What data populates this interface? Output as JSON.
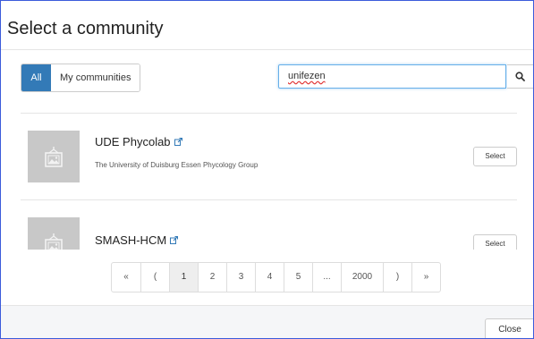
{
  "dialog": {
    "title": "Select a community"
  },
  "filter": {
    "tabs": [
      {
        "label": "All",
        "active": true
      },
      {
        "label": "My communities",
        "active": false
      }
    ]
  },
  "search": {
    "value": "unifezen",
    "icon": "search-icon"
  },
  "communities": [
    {
      "name": "UDE Phycolab",
      "description": "The University of Duisburg Essen Phycology Group",
      "select_label": "Select",
      "thumbnail_icon": "image-placeholder-icon",
      "link_icon": "external-link-icon"
    },
    {
      "name": "SMASH-HCM",
      "description": "",
      "select_label": "Select",
      "thumbnail_icon": "image-placeholder-icon",
      "link_icon": "external-link-icon"
    }
  ],
  "pagination": {
    "first": "«",
    "prev": "(",
    "pages": [
      "1",
      "2",
      "3",
      "4",
      "5",
      "...",
      "2000"
    ],
    "current": "1",
    "next": ")",
    "last": "»"
  },
  "footer": {
    "close_label": "Close"
  },
  "colors": {
    "accent": "#337ab7",
    "focus_border": "#66afe9",
    "thumbnail": "#c8c8c8",
    "footer_bg": "#f5f6f8"
  }
}
